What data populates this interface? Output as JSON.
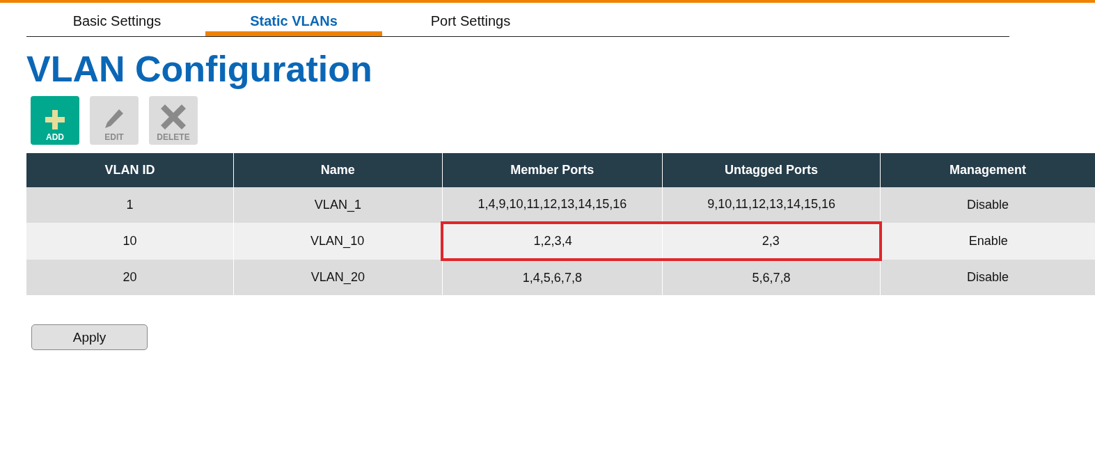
{
  "tabs": [
    {
      "label": "Basic Settings",
      "selected": false
    },
    {
      "label": "Static VLANs",
      "selected": true
    },
    {
      "label": "Port Settings",
      "selected": false
    }
  ],
  "title": "VLAN Configuration",
  "toolbar": [
    {
      "kind": "add",
      "label": "ADD",
      "disabled": false
    },
    {
      "kind": "edit",
      "label": "EDIT",
      "disabled": true
    },
    {
      "kind": "delete",
      "label": "DELETE",
      "disabled": true
    }
  ],
  "table": {
    "columns": [
      "VLAN ID",
      "Name",
      "Member Ports",
      "Untagged Ports",
      "Management"
    ],
    "rows": [
      {
        "cells": [
          "1",
          "VLAN_1",
          "1,4,9,10,11,12,13,14,15,16",
          "9,10,11,12,13,14,15,16",
          "Disable"
        ],
        "highlighted": false
      },
      {
        "cells": [
          "10",
          "VLAN_10",
          "1,2,3,4",
          "2,3",
          "Enable"
        ],
        "highlighted": true
      },
      {
        "cells": [
          "20",
          "VLAN_20",
          "1,4,5,6,7,8",
          "5,6,7,8",
          "Disable"
        ],
        "highlighted": false
      }
    ]
  },
  "apply_button": "Apply"
}
